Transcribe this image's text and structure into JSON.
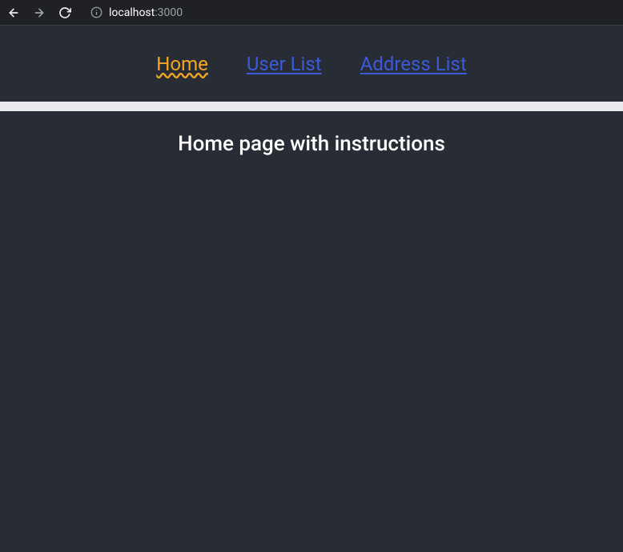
{
  "browser": {
    "url_host": "localhost",
    "url_port": ":3000"
  },
  "nav": {
    "links": [
      {
        "label": "Home",
        "active": true
      },
      {
        "label": "User List",
        "active": false
      },
      {
        "label": "Address List",
        "active": false
      }
    ]
  },
  "main": {
    "heading": "Home page with instructions"
  }
}
